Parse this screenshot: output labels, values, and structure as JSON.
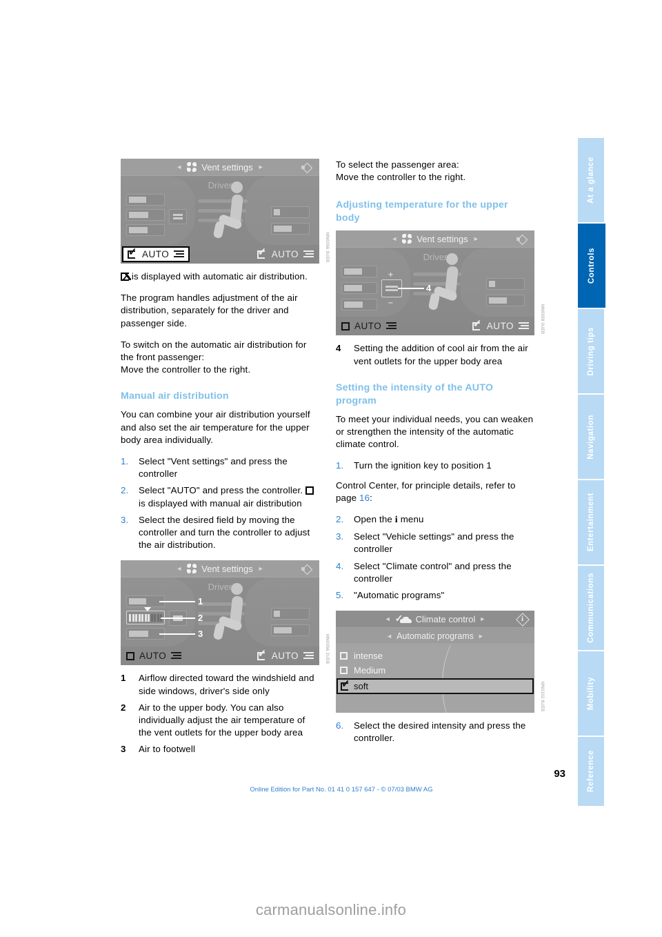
{
  "page": {
    "number": "93",
    "edition_line": "Online Edition for Part No. 01 41 0 157 647 - © 07/03 BMW AG",
    "watermark": "carmanualsonline.info"
  },
  "rail": {
    "tabs": [
      {
        "label": "At a glance",
        "active": false
      },
      {
        "label": "Controls",
        "active": true
      },
      {
        "label": "Driving tips",
        "active": false
      },
      {
        "label": "Navigation",
        "active": false
      },
      {
        "label": "Entertainment",
        "active": false
      },
      {
        "label": "Communications",
        "active": false
      },
      {
        "label": "Mobility",
        "active": false
      },
      {
        "label": "Reference",
        "active": false
      }
    ]
  },
  "left_column": {
    "screenshot_1": {
      "code": "MN0056 9UEB",
      "header_title": "Vent settings",
      "zone_label": "Driver",
      "driver_button_label": "AUTO",
      "passenger_button_label": "AUTO",
      "driver_button_icon": "check-icon",
      "passenger_button_icon": "check-icon"
    },
    "para_auto_icon": "is displayed with automatic air distribution.",
    "para_program": "The program handles adjustment of the air distribution, separately for the driver and passenger side.",
    "para_switch_on": "To switch on the automatic air distribution for the front passenger:",
    "para_move_right": "Move the controller to the right.",
    "heading_manual": "Manual air distribution",
    "para_combine": "You can combine your air distribution yourself and also set the air temperature for the upper body area individually.",
    "steps": [
      {
        "num": "1.",
        "text": "Select \"Vent settings\" and press the controller"
      },
      {
        "num": "2.",
        "text_before": "Select \"AUTO\" and press the controller.",
        "text_after": "is displayed with manual air distribution"
      },
      {
        "num": "3.",
        "text": "Select the desired field by moving the controller and turn the controller to adjust the air distribution."
      }
    ],
    "screenshot_2": {
      "code": "MN0056 2UEB",
      "header_title": "Vent settings",
      "zone_label": "Driver",
      "driver_button_label": "AUTO",
      "passenger_button_label": "AUTO",
      "driver_button_icon": "square-icon",
      "passenger_button_icon": "check-icon",
      "callouts": [
        "1",
        "2",
        "3"
      ]
    },
    "keys": [
      {
        "num": "1",
        "text": "Airflow directed toward the windshield and side windows, driver's side only"
      },
      {
        "num": "2",
        "text": "Air to the upper body. You can also individually adjust the air temperature of the vent outlets for the upper body area"
      },
      {
        "num": "3",
        "text": "Air to footwell"
      }
    ]
  },
  "right_column": {
    "para_select_passenger": "To select the passenger area:",
    "para_move_right": "Move the controller to the right.",
    "heading_adjusting": "Adjusting temperature for the upper body",
    "screenshot_3": {
      "code": "MN0058 0UEB",
      "header_title": "Vent settings",
      "zone_label": "Driver",
      "driver_button_label": "AUTO",
      "passenger_button_label": "AUTO",
      "driver_button_icon": "square-icon",
      "passenger_button_icon": "check-icon",
      "plus_label": "+",
      "minus_label": "–",
      "callout": "4"
    },
    "key_4": {
      "num": "4",
      "text": "Setting the addition of cool air from the air vent outlets for the upper body area"
    },
    "heading_intensity": "Setting the intensity of the AUTO program",
    "para_individual": "To meet your individual needs, you can weaken or strengthen the intensity of the automatic climate control.",
    "steps_a": [
      {
        "num": "1.",
        "text": "Turn the ignition key to position 1"
      }
    ],
    "para_control_center_before": "Control Center, for principle details, refer to page",
    "para_control_center_ref": "16",
    "para_control_center_after": ":",
    "steps_b": [
      {
        "num": "2.",
        "text_before": "Open the",
        "icon": "i",
        "text_after": "menu"
      },
      {
        "num": "3.",
        "text": "Select \"Vehicle settings\" and press the controller"
      },
      {
        "num": "4.",
        "text": "Select \"Climate control\" and press the controller"
      },
      {
        "num": "5.",
        "text": "\"Automatic programs\""
      }
    ],
    "screenshot_4": {
      "code": "MN0102 6UEB",
      "header_title": "Climate control",
      "header_icon": "check-car-icon",
      "sub_title": "Automatic programs",
      "options": [
        {
          "label": "intense",
          "icon": "square-icon",
          "selected": false
        },
        {
          "label": "Medium",
          "icon": "square-icon",
          "selected": false
        },
        {
          "label": "soft",
          "icon": "check-icon",
          "selected": true
        }
      ]
    },
    "steps_c": [
      {
        "num": "6.",
        "text": "Select the desired intensity and press the controller."
      }
    ]
  }
}
